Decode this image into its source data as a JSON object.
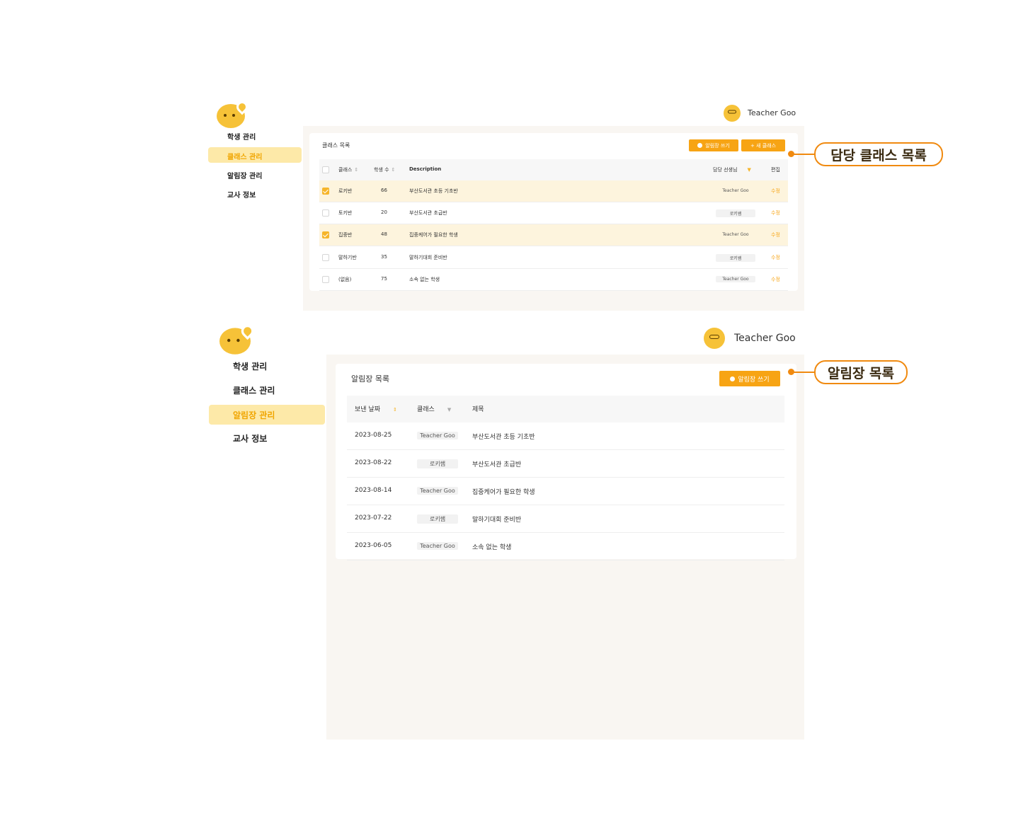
{
  "brand": {
    "accent": "#f7a414",
    "highlight": "#fde9a8",
    "callout": "#f08a10"
  },
  "top": {
    "user_name": "Teacher Goo",
    "nav": [
      "학생 관리",
      "클래스 관리",
      "알림장 관리",
      "교사 정보"
    ],
    "active_nav": "클래스 관리",
    "card_title": "클래스 목록",
    "btn_notice": "알림장 쓰기",
    "btn_new_class": "+ 새 클래스",
    "columns": [
      "클래스",
      "학생 수",
      "Description",
      "담당 선생님",
      "편집"
    ],
    "rows": [
      {
        "selected": true,
        "class": "로키반",
        "count": "66",
        "desc": "부산도서관 초등 기초반",
        "teacher": "Teacher Goo",
        "edit": "수정"
      },
      {
        "selected": false,
        "class": "토키반",
        "count": "20",
        "desc": "부산도서관 초급반",
        "teacher": "로키쌤",
        "edit": "수정"
      },
      {
        "selected": true,
        "class": "집중반",
        "count": "48",
        "desc": "집중케어가 필요한 학생",
        "teacher": "Teacher Goo",
        "edit": "수정"
      },
      {
        "selected": false,
        "class": "말하기반",
        "count": "35",
        "desc": "말하기대회 준비반",
        "teacher": "로키쌤",
        "edit": "수정"
      },
      {
        "selected": false,
        "class": "(없음)",
        "count": "75",
        "desc": "소속 없는 학생",
        "teacher": "Teacher Goo",
        "edit": "수정"
      }
    ],
    "callout": "담당 클래스 목록"
  },
  "bottom": {
    "user_name": "Teacher Goo",
    "nav": [
      "학생 관리",
      "클래스 관리",
      "알림장 관리",
      "교사 정보"
    ],
    "active_nav": "알림장 관리",
    "card_title": "알림장 목록",
    "btn_notice": "알림장 쓰기",
    "columns": [
      "보낸 날짜",
      "클래스",
      "제목"
    ],
    "rows": [
      {
        "date": "2023-08-25",
        "class": "Teacher Goo",
        "title": "부산도서관 초등 기초반"
      },
      {
        "date": "2023-08-22",
        "class": "로키쌤",
        "title": "부산도서관 초급반"
      },
      {
        "date": "2023-08-14",
        "class": "Teacher Goo",
        "title": "집중케어가 필요한 학생"
      },
      {
        "date": "2023-07-22",
        "class": "로키쌤",
        "title": "말하기대회 준비반"
      },
      {
        "date": "2023-06-05",
        "class": "Teacher Goo",
        "title": "소속 없는 학생"
      }
    ],
    "callout": "알림장 목록"
  }
}
